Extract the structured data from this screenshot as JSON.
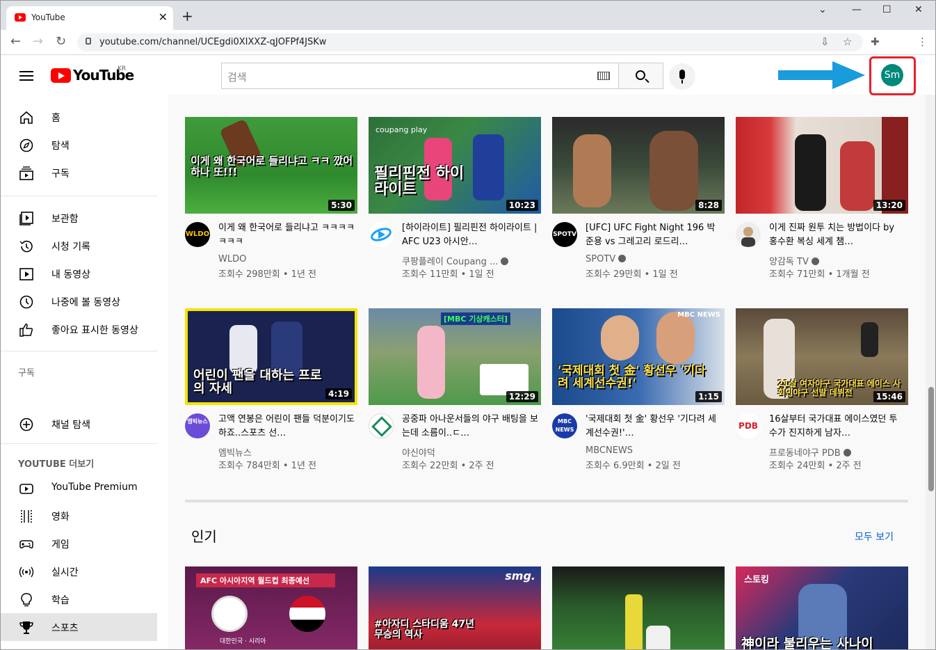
{
  "browser": {
    "tab_title": "YouTube",
    "url": "youtube.com/channel/UCEgdi0XIXXZ-qJOFPf4JSKw"
  },
  "header": {
    "logo_text": "YouTube",
    "region": "KR",
    "search_placeholder": "검색",
    "avatar_initials": "Sm"
  },
  "sidebar": {
    "primary": [
      {
        "label": "홈",
        "icon": "home-icon"
      },
      {
        "label": "탐색",
        "icon": "compass-icon"
      },
      {
        "label": "구독",
        "icon": "subscriptions-icon"
      }
    ],
    "library": [
      {
        "label": "보관함",
        "icon": "library-icon"
      },
      {
        "label": "시청 기록",
        "icon": "history-icon"
      },
      {
        "label": "내 동영상",
        "icon": "my-videos-icon"
      },
      {
        "label": "나중에 볼 동영상",
        "icon": "watch-later-icon"
      },
      {
        "label": "좋아요 표시한 동영상",
        "icon": "thumbs-up-icon"
      }
    ],
    "subs_heading": "구독",
    "browse_channels": "채널 탐색",
    "more_heading": "YOUTUBE 더보기",
    "more": [
      {
        "label": "YouTube Premium",
        "icon": "youtube-premium-icon"
      },
      {
        "label": "영화",
        "icon": "film-icon"
      },
      {
        "label": "게임",
        "icon": "gamepad-icon"
      },
      {
        "label": "실시간",
        "icon": "live-icon"
      },
      {
        "label": "학습",
        "icon": "lightbulb-icon"
      },
      {
        "label": "스포츠",
        "icon": "trophy-icon"
      }
    ]
  },
  "videos": [
    {
      "title": "이게 왜 한국어로 들리냐고 ㅋㅋㅋㅋㅋㅋㅋ",
      "channel": "WLDO",
      "meta": "조회수 298만회 • 1년 전",
      "duration": "5:30",
      "caption": "이게 왜 한국어로 들리냐고 ㅋㅋ 깠어 하나 또!!!",
      "avatar_text": "WLDO",
      "verified": false
    },
    {
      "title": "[하이라이트] 필리핀전 하이라이트 | AFC U23 아시안…",
      "channel": "쿠팡플레이 Coupang ...",
      "meta": "조회수 11만회 • 1일 전",
      "duration": "10:23",
      "caption": "필리핀전 하이라이트",
      "avatar_text": "",
      "verified": true
    },
    {
      "title": "[UFC] UFC Fight Night 196 박준용 vs 그레고리 로드리…",
      "channel": "SPOTV",
      "meta": "조회수 29만회 • 1일 전",
      "duration": "8:28",
      "caption": "",
      "avatar_text": "SPOTV",
      "verified": true
    },
    {
      "title": "이게 진짜 원투 치는 방법이다 by 홍수환 복싱 세계 챔…",
      "channel": "양감독 TV",
      "meta": "조회수 71만회 • 1개월 전",
      "duration": "13:20",
      "caption": "",
      "avatar_text": "",
      "verified": true
    },
    {
      "title": "고액 연봉은 어린이 팬들 덕분이기도 하죠..스포츠 선…",
      "channel": "엠빅뉴스",
      "meta": "조회수 784만회 • 1년 전",
      "duration": "4:19",
      "caption": "어린이 팬을 대하는 프로의 자세",
      "avatar_text": "엠빅뉴스",
      "verified": false
    },
    {
      "title": "공중파 아나운서들의 야구 배팅을 보는데 소름이..ㄷ…",
      "channel": "야신야덕",
      "meta": "조회수 22만회 • 2주 전",
      "duration": "12:29",
      "caption": "[MBC 기상캐스터]",
      "avatar_text": "",
      "verified": false
    },
    {
      "title": "'국제대회 첫 金' 황선우 '기다려 세계선수권!'…",
      "channel": "MBCNEWS",
      "meta": "조회수 6.9만회 • 2일 전",
      "duration": "1:15",
      "caption": "'국제대회 첫 金' 황선우 '기다려 세계선수권!'",
      "avatar_text": "MBC NEWS",
      "verified": false
    },
    {
      "title": "16살부터 국가대표 에이스였던 투수가 진지하게 남자…",
      "channel": "프로동네야구 PDB",
      "meta": "조회수 24만회 • 2주 전",
      "duration": "15:46",
      "caption": "21살 여자야구 국가대표 에이스 사회인야구 선발 데뷔전",
      "avatar_text": "PDB",
      "verified": true
    }
  ],
  "section": {
    "title": "인기",
    "see_all": "모두 보기"
  },
  "popular_captions": [
    {
      "caption": "AFC 아시아지역 월드컵 최종예선",
      "sub": "대한민국 · 시리아"
    },
    {
      "caption": "#아자디 스타디움 47년 무승의 역사",
      "sub": "smg."
    },
    {
      "caption": "",
      "sub": ""
    },
    {
      "caption": "神이라 불리우는 사나이",
      "sub": "스토킹"
    }
  ],
  "colors": {
    "brand_red": "#ff0000",
    "link_blue": "#065fd4",
    "avatar_bg": "#00897b",
    "highlight_red": "#e8202a",
    "arrow_blue": "#1a9bdc"
  }
}
